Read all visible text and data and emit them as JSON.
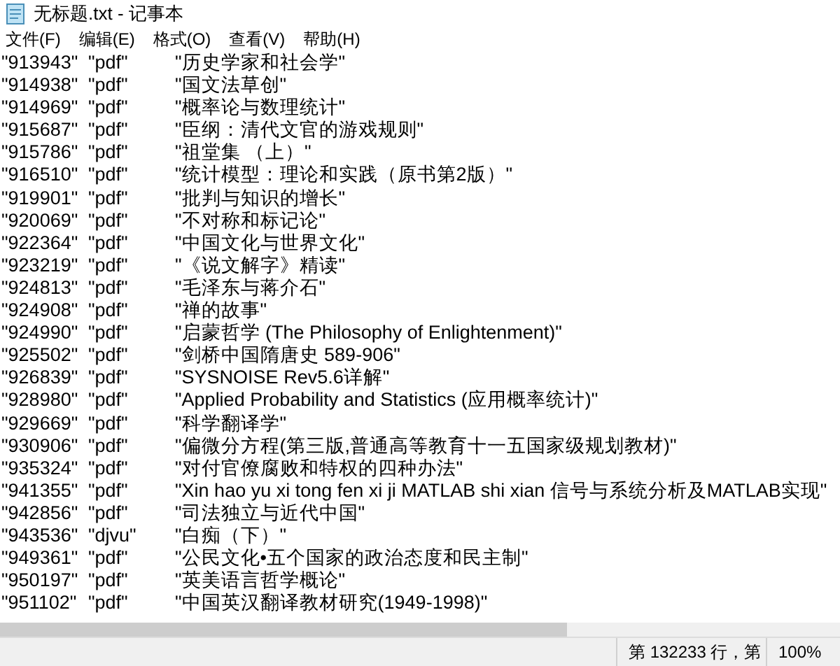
{
  "window": {
    "title": "无标题.txt - 记事本"
  },
  "menu": [
    "文件(F)",
    "编辑(E)",
    "格式(O)",
    "查看(V)",
    "帮助(H)"
  ],
  "lines": [
    "\"913943\"\t\"pdf\"\t\"历史学家和社会学\"",
    "\"914938\"\t\"pdf\"\t\"国文法草创\"",
    "\"914969\"\t\"pdf\"\t\"概率论与数理统计\"",
    "\"915687\"\t\"pdf\"\t\"臣纲：清代文官的游戏规则\"",
    "\"915786\"\t\"pdf\"\t\"祖堂集 （上）\"",
    "\"916510\"\t\"pdf\"\t\"统计模型：理论和实践（原书第2版）\"",
    "\"919901\"\t\"pdf\"\t\"批判与知识的增长\"",
    "\"920069\"\t\"pdf\"\t\"不对称和标记论\"",
    "\"922364\"\t\"pdf\"\t\"中国文化与世界文化\"",
    "\"923219\"\t\"pdf\"\t\"《说文解字》精读\"",
    "\"924813\"\t\"pdf\"\t\"毛泽东与蒋介石\"",
    "\"924908\"\t\"pdf\"\t\"禅的故事\"",
    "\"924990\"\t\"pdf\"\t\"启蒙哲学 (The Philosophy of Enlightenment)\"",
    "\"925502\"\t\"pdf\"\t\"剑桥中国隋唐史 589-906\"",
    "\"926839\"\t\"pdf\"\t\"SYSNOISE Rev5.6详解\"",
    "\"928980\"\t\"pdf\"\t\"Applied Probability and Statistics (应用概率统计)\"",
    "\"929669\"\t\"pdf\"\t\"科学翻译学\"",
    "\"930906\"\t\"pdf\"\t\"偏微分方程(第三版,普通高等教育十一五国家级规划教材)\"",
    "\"935324\"\t\"pdf\"\t\"对付官僚腐败和特权的四种办法\"",
    "\"941355\"\t\"pdf\"\t\"Xin hao yu xi tong fen xi ji MATLAB shi xian 信号与系统分析及MATLAB实现\"",
    "\"942856\"\t\"pdf\"\t\"司法独立与近代中国\"",
    "\"943536\"\t\"djvu\"\t\"白痴（下）\"",
    "\"949361\"\t\"pdf\"\t\"公民文化•五个国家的政治态度和民主制\"",
    "\"950197\"\t\"pdf\"\t\"英美语言哲学概论\"",
    "\"951102\"\t\"pdf\"\t\"中国英汉翻译教材研究(1949-1998)\""
  ],
  "status_bar": {
    "position": "第 132233 行，第",
    "zoom": "100%"
  }
}
